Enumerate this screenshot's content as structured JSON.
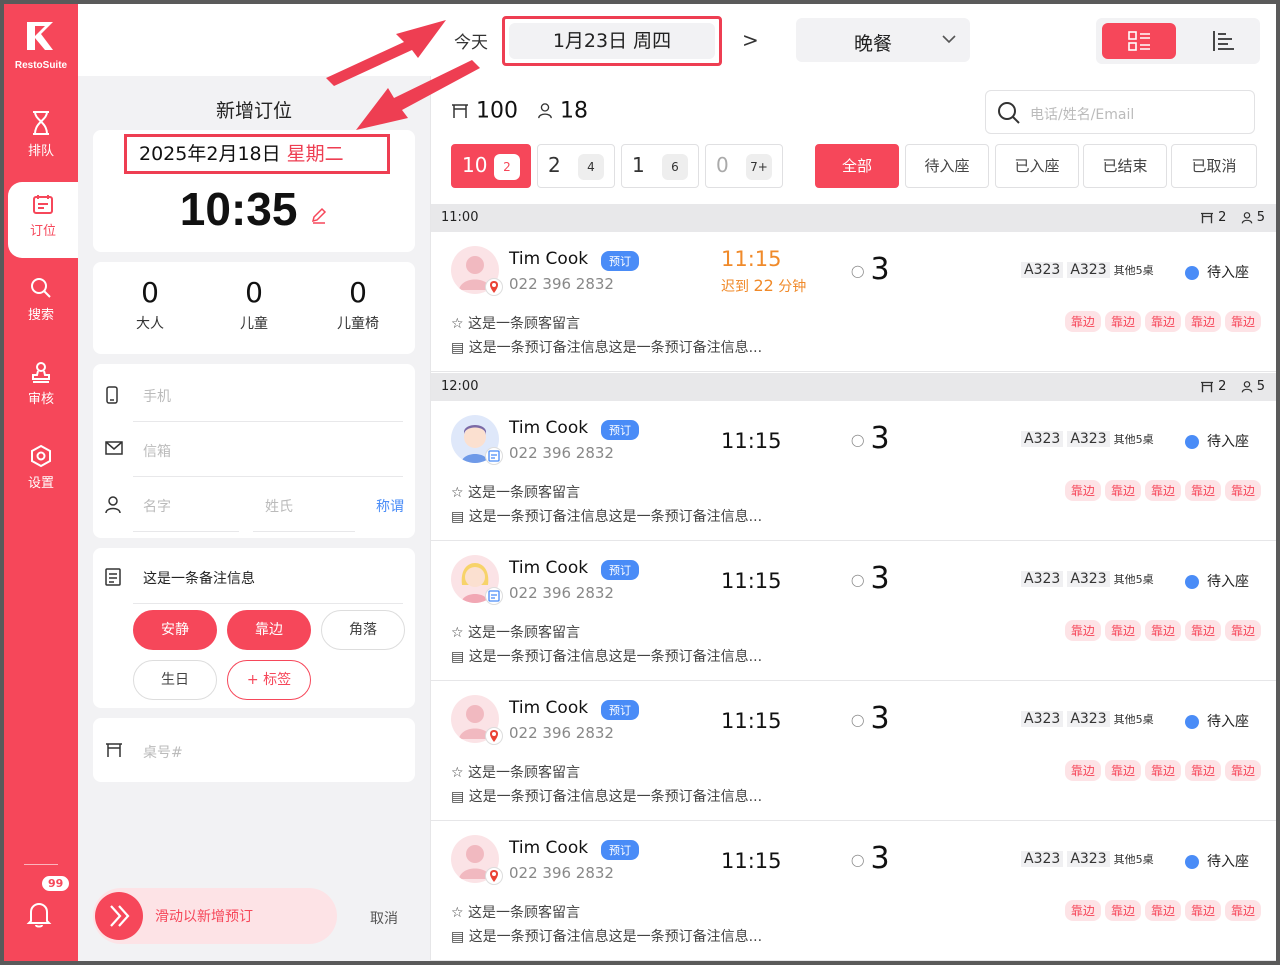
{
  "app": {
    "brand": "RestoSuite"
  },
  "sidebar": {
    "items": [
      {
        "label": "排队",
        "icon": "hourglass-icon"
      },
      {
        "label": "订位",
        "icon": "calendar-icon",
        "active": true
      },
      {
        "label": "搜索",
        "icon": "search-icon"
      },
      {
        "label": "审核",
        "icon": "stamp-icon"
      },
      {
        "label": "设置",
        "icon": "settings-icon"
      }
    ],
    "notification_count": "99"
  },
  "topbar": {
    "today_label": "今天",
    "date_label": "1月23日 周四",
    "next_arrow": ">",
    "meal_label": "晚餐"
  },
  "form": {
    "title": "新增订位",
    "date": "2025年2月18日",
    "weekday": "星期二",
    "time": "10:35",
    "counts": [
      {
        "value": "0",
        "label": "大人"
      },
      {
        "value": "0",
        "label": "儿童"
      },
      {
        "value": "0",
        "label": "儿童椅"
      }
    ],
    "phone_placeholder": "手机",
    "email_placeholder": "信箱",
    "first_name_placeholder": "名字",
    "last_name_placeholder": "姓氏",
    "title_link": "称谓",
    "note": "这是一条备注信息",
    "tags": [
      {
        "label": "安静",
        "selected": true
      },
      {
        "label": "靠边",
        "selected": true
      },
      {
        "label": "角落",
        "selected": false
      },
      {
        "label": "生日",
        "selected": false
      }
    ],
    "add_tag": "+ 标签",
    "table_placeholder": "桌号#",
    "slide_label": "滑动以新增预订",
    "cancel_label": "取消"
  },
  "list": {
    "total_tables": "100",
    "total_guests": "18",
    "search_placeholder": "电话/姓名/Email",
    "party_sizes": [
      {
        "count": "10",
        "size": "2",
        "active": true
      },
      {
        "count": "2",
        "size": "4",
        "active": false
      },
      {
        "count": "1",
        "size": "6",
        "active": false
      },
      {
        "count": "0",
        "size": "7+",
        "active": false
      }
    ],
    "filters": [
      {
        "label": "全部",
        "active": true
      },
      {
        "label": "待入座",
        "active": false
      },
      {
        "label": "已入座",
        "active": false
      },
      {
        "label": "已结束",
        "active": false
      },
      {
        "label": "已取消",
        "active": false
      }
    ],
    "groups": [
      {
        "time": "11:00",
        "tables": "2",
        "guests": "5"
      },
      {
        "time": "12:00",
        "tables": "2",
        "guests": "5"
      }
    ],
    "reservations": [
      {
        "name": "Tim Cook",
        "tag": "预订",
        "phone": "022 396 2832",
        "time": "11:15",
        "late_prefix": "迟到",
        "late_num": "22",
        "late_suffix": "分钟",
        "pax": "3",
        "table1": "A323",
        "table2": "A323",
        "more_tables": "其他5桌",
        "status": "待入座",
        "note": "这是一条顾客留言",
        "remark": "这是一条预订备注信息这是一条预订备注信息...",
        "tags": [
          "靠边",
          "靠边",
          "靠边",
          "靠边",
          "靠边"
        ],
        "source": "google"
      },
      {
        "name": "Tim Cook",
        "tag": "预订",
        "phone": "022 396 2832",
        "time": "11:15",
        "pax": "3",
        "table1": "A323",
        "table2": "A323",
        "more_tables": "其他5桌",
        "status": "待入座",
        "note": "这是一条顾客留言",
        "remark": "这是一条预订备注信息这是一条预订备注信息...",
        "tags": [
          "靠边",
          "靠边",
          "靠边",
          "靠边",
          "靠边"
        ],
        "source": "book"
      },
      {
        "name": "Tim Cook",
        "tag": "预订",
        "phone": "022 396 2832",
        "time": "11:15",
        "pax": "3",
        "table1": "A323",
        "table2": "A323",
        "more_tables": "其他5桌",
        "status": "待入座",
        "note": "这是一条顾客留言",
        "remark": "这是一条预订备注信息这是一条预订备注信息...",
        "tags": [
          "靠边",
          "靠边",
          "靠边",
          "靠边",
          "靠边"
        ],
        "source": "book"
      },
      {
        "name": "Tim Cook",
        "tag": "预订",
        "phone": "022 396 2832",
        "time": "11:15",
        "pax": "3",
        "table1": "A323",
        "table2": "A323",
        "more_tables": "其他5桌",
        "status": "待入座",
        "note": "这是一条顾客留言",
        "remark": "这是一条预订备注信息这是一条预订备注信息...",
        "tags": [
          "靠边",
          "靠边",
          "靠边",
          "靠边",
          "靠边"
        ],
        "source": "google"
      },
      {
        "name": "Tim Cook",
        "tag": "预订",
        "phone": "022 396 2832",
        "time": "11:15",
        "pax": "3",
        "table1": "A323",
        "table2": "A323",
        "more_tables": "其他5桌",
        "status": "待入座",
        "note": "这是一条顾客留言",
        "remark": "这是一条预订备注信息这是一条预订备注信息...",
        "tags": [
          "靠边",
          "靠边",
          "靠边",
          "靠边",
          "靠边"
        ],
        "source": "google"
      }
    ]
  },
  "colors": {
    "accent": "#f6475a",
    "late": "#f08a2a",
    "info": "#4a8cf7"
  }
}
